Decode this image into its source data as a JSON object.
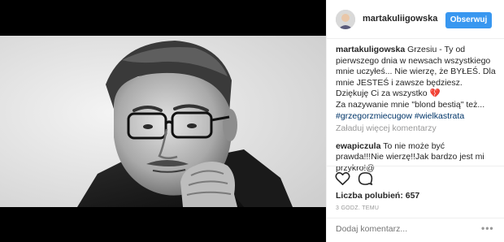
{
  "header": {
    "username": "martakuliigowska",
    "follow_label": "Obserwuj"
  },
  "caption": {
    "username": "martakuligowska",
    "lines": [
      "Grzesiu - Ty od",
      "pierwszego dnia w newsach wszystkiego",
      "mnie uczyłeś... Nie wierzę, że BYŁEŚ. Dla",
      "mnie JESTEŚ i zawsze będziesz.",
      "Dziękuję Ci za wszystko",
      "Za nazywanie mnie \"blond bestią\" też...",
      "#grzegorzmiecugow #wielkastrata"
    ],
    "heart_emoji": "💔"
  },
  "load_more_comments": "Załaduj więcej komentarzy",
  "comment": {
    "username": "ewapiczula",
    "lines": [
      "To nie może być",
      "prawda!!!Nie wierzę!!Jak bardzo jest mi",
      "przykro!@"
    ]
  },
  "likes_text": "Liczba polubień: 657",
  "timestamp": "3 GODZ. TEMU",
  "add_comment_placeholder": "Dodaj komentarz...",
  "more_options": "•••",
  "colors": {
    "follow_button": "#3897f0",
    "hashtag": "#003569",
    "muted_text": "#999999"
  }
}
